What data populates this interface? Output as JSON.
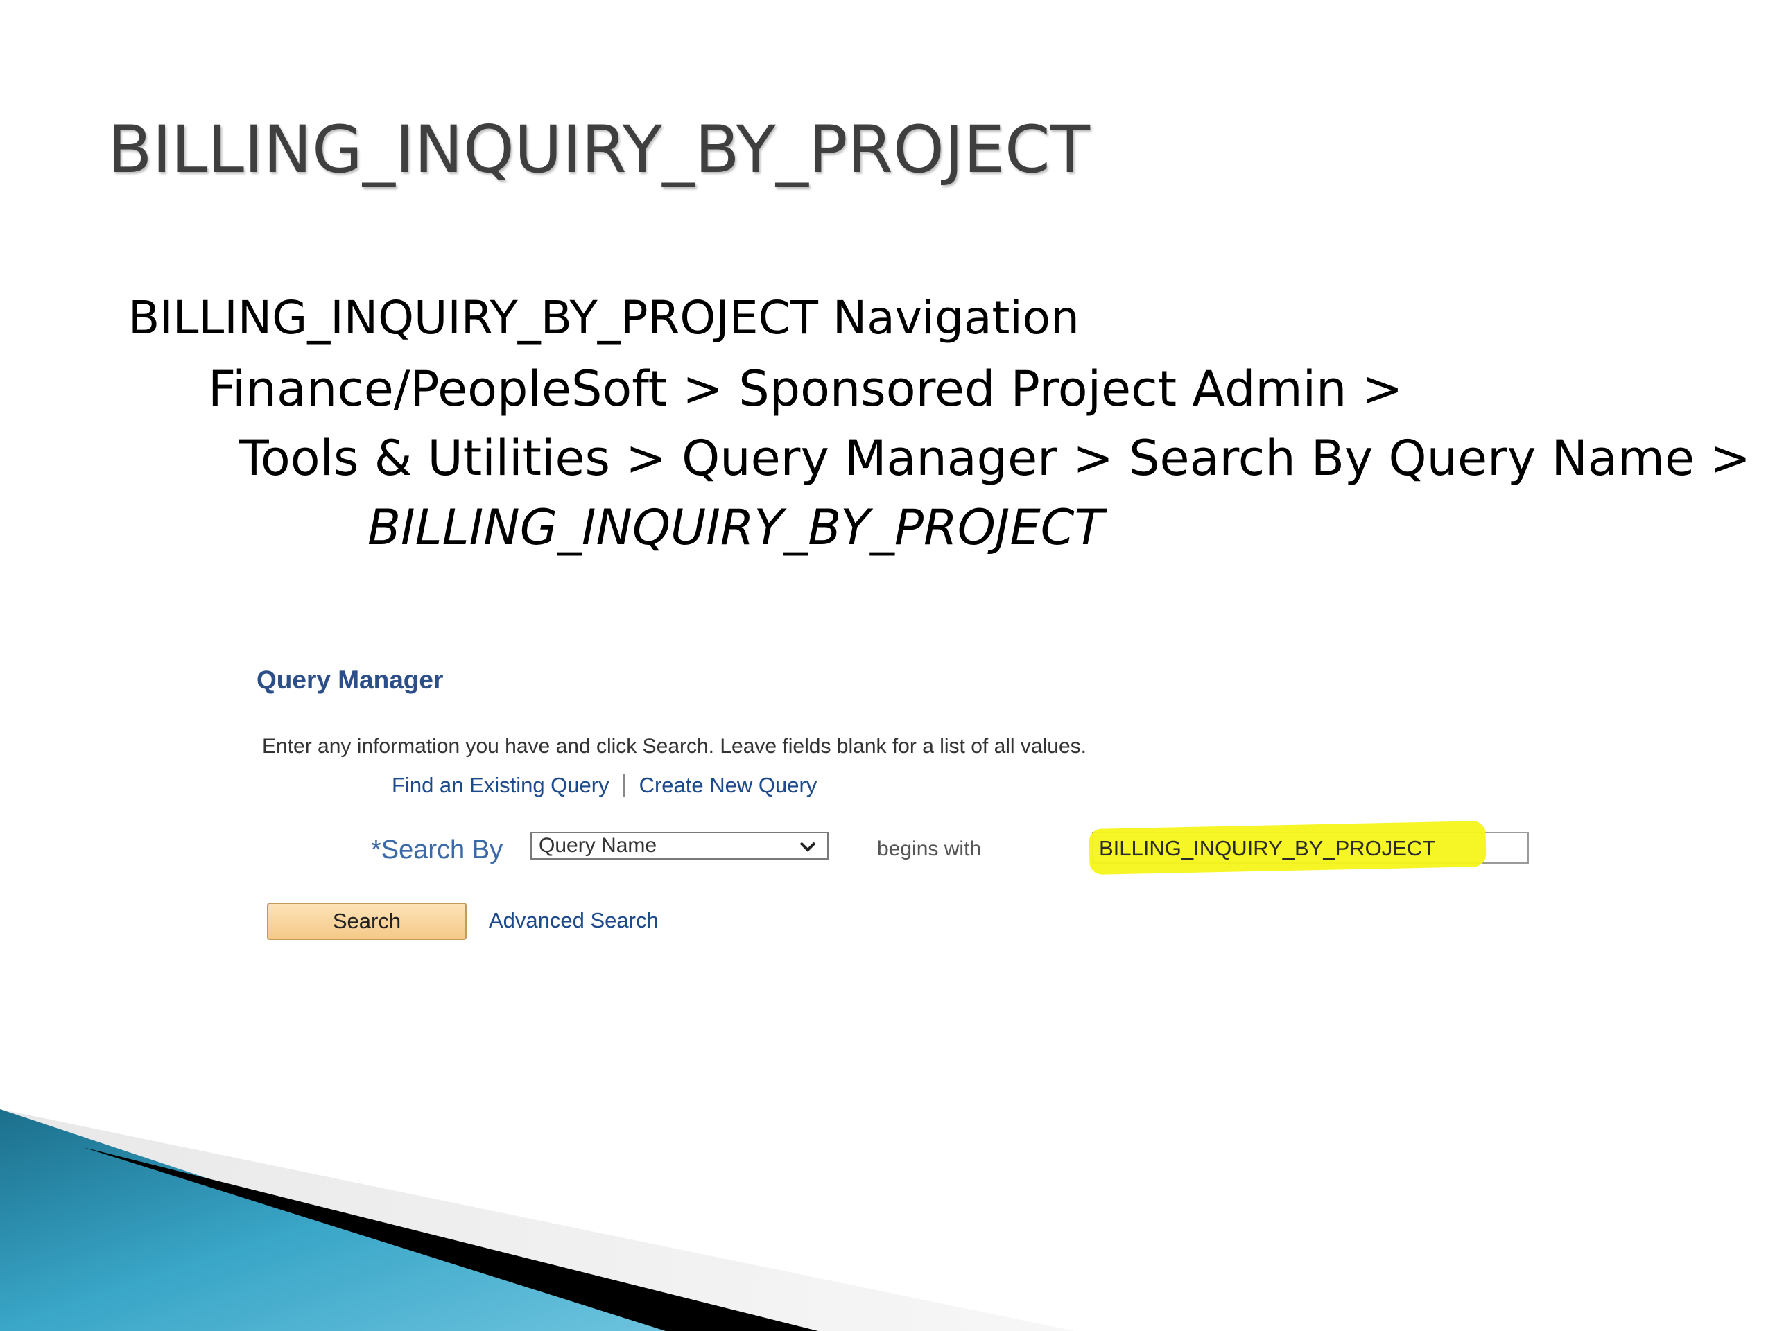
{
  "slide": {
    "title": "BILLING_INQUIRY_BY_PROJECT",
    "nav_heading": "BILLING_INQUIRY_BY_PROJECT Navigation",
    "nav_line_1": "Finance/PeopleSoft > Sponsored Project Admin >",
    "nav_line_2": "Tools & Utilities > Query Manager > Search By Query Name >",
    "nav_line_3": "BILLING_INQUIRY_BY_PROJECT"
  },
  "query_manager": {
    "title": "Query Manager",
    "instructions": "Enter any information you have and click Search. Leave fields blank for a list of all values.",
    "tabs": {
      "find_existing": "Find an Existing Query",
      "create_new": "Create New Query"
    },
    "search_by_label": "*Search By",
    "search_by_value": "Query Name",
    "operator_label": "begins with",
    "search_value": "BILLING_INQUIRY_BY_PROJECT",
    "search_button": "Search",
    "advanced_search": "Advanced Search",
    "highlight_color": "#f5f51a",
    "link_color": "#1c4a8c",
    "button_color": "#fde3b8"
  },
  "decor": {
    "teal": "#2a8fb0",
    "black": "#000000"
  }
}
